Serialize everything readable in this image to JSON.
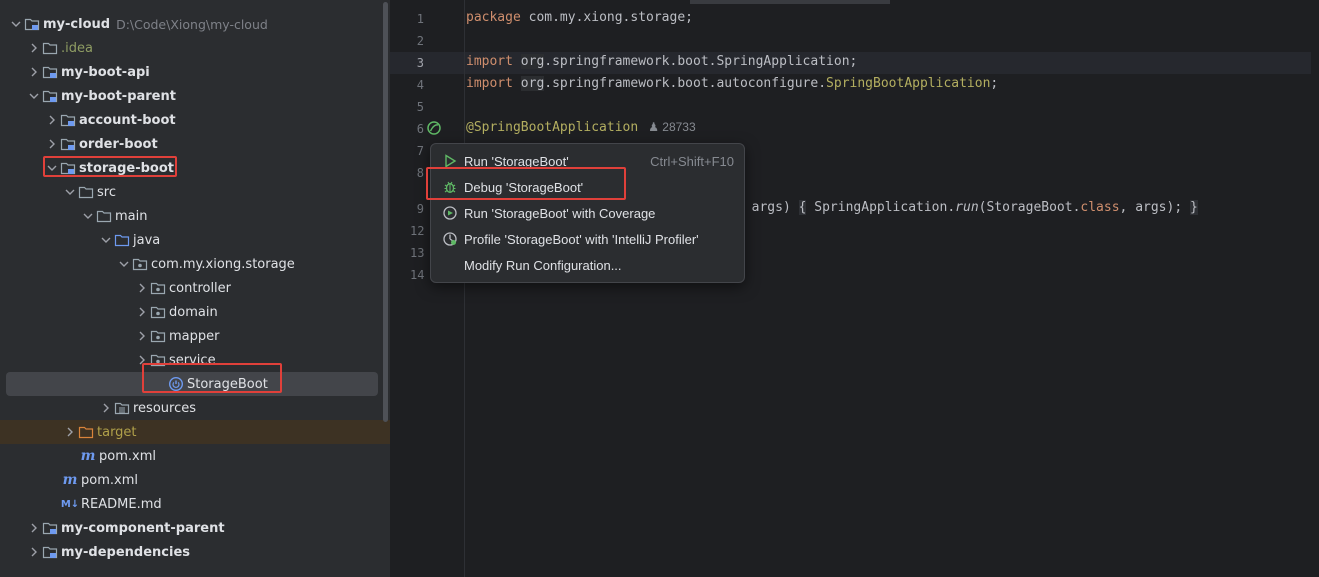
{
  "tree": {
    "root": {
      "label": "my-cloud",
      "path": "D:\\Code\\Xiong\\my-cloud"
    },
    "items": [
      {
        "label": ".idea"
      },
      {
        "label": "my-boot-api"
      },
      {
        "label": "my-boot-parent"
      },
      {
        "label": "account-boot"
      },
      {
        "label": "order-boot"
      },
      {
        "label": "storage-boot"
      },
      {
        "label": "src"
      },
      {
        "label": "main"
      },
      {
        "label": "java"
      },
      {
        "label": "com.my.xiong.storage"
      },
      {
        "label": "controller"
      },
      {
        "label": "domain"
      },
      {
        "label": "mapper"
      },
      {
        "label": "service"
      },
      {
        "label": "StorageBoot"
      },
      {
        "label": "resources"
      },
      {
        "label": "target"
      },
      {
        "label": "pom.xml"
      },
      {
        "label": "pom.xml"
      },
      {
        "label": "README.md"
      },
      {
        "label": "my-component-parent"
      },
      {
        "label": "my-dependencies"
      }
    ],
    "icons": {
      "maven_letter": "m",
      "markdown_badge": "M↓"
    }
  },
  "editor": {
    "line_numbers": [
      "1",
      "2",
      "3",
      "4",
      "5",
      "6",
      "7",
      "8",
      "9",
      "12",
      "13",
      "14"
    ],
    "code": {
      "l1_kw": "package",
      "l1_rest": " com.my.xiong.storage;",
      "l3_kw": "import",
      "l3_pkg": "org",
      "l3_rest": ".springframework.boot.SpringApplication;",
      "l4_kw": "import",
      "l4_pkg": "org",
      "l4_rest": ".springframework.boot.autoconfigure.",
      "l4_cls": "SpringBootApplication",
      "l4_end": ";",
      "l6_ann": "@SpringBootApplication",
      "l6_usages": "28733",
      "l9_a": "] args)",
      "l9_b": "{",
      "l9_c": " SpringApplication.",
      "l9_fn": "run",
      "l9_d": "(StorageBoot.",
      "l9_kw": "class",
      "l9_e": ", args);",
      "l9_f": "}"
    }
  },
  "popup": {
    "items": [
      {
        "label": "Run 'StorageBoot'",
        "shortcut": "Ctrl+Shift+F10"
      },
      {
        "label": "Debug 'StorageBoot'"
      },
      {
        "label": "Run 'StorageBoot' with Coverage"
      },
      {
        "label": "Profile 'StorageBoot' with 'IntelliJ Profiler'"
      },
      {
        "label": "Modify Run Configuration..."
      }
    ]
  },
  "colors": {
    "highlight": "#e0403a",
    "folder": "#9aa7b0",
    "module_folder": "#6e9af0",
    "run_green": "#5fb865",
    "keyword": "#cf8e6d",
    "annotation": "#b3ae60"
  }
}
